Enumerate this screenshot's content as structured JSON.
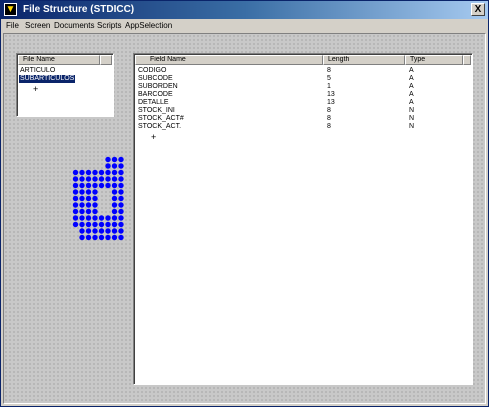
{
  "window": {
    "title": "File Structure (STDICC)",
    "close_label": "X"
  },
  "menu": [
    "File",
    "Screen",
    "Documents",
    "Scripts",
    "AppSelection"
  ],
  "files_panel": {
    "header": "File Name",
    "items": [
      "ARTICULO",
      "SUBARTICULOS"
    ],
    "selected_index": 1,
    "add_symbol": "+"
  },
  "fields_panel": {
    "columns": [
      "Field Name",
      "Length",
      "Type"
    ],
    "rows": [
      [
        "CODIGO",
        "8",
        "A"
      ],
      [
        "SUBCODE",
        "5",
        "A"
      ],
      [
        "SUBORDEN",
        "1",
        "A"
      ],
      [
        "BARCODE",
        "13",
        "A"
      ],
      [
        "DETALLE",
        "13",
        "A"
      ],
      [
        "STOCK_INI",
        "8",
        "N"
      ],
      [
        "STOCK_ACT#",
        "8",
        "N"
      ],
      [
        "STOCK_ACT.",
        "8",
        "N"
      ]
    ],
    "add_symbol": "+"
  },
  "icons": {
    "app": "app-logo-icon",
    "close": "close-icon",
    "decor": "blue-dot-pattern-icon"
  },
  "colors": {
    "titlebar": "#0a246a",
    "selection": "#0a246a",
    "dots": "#0000ff"
  }
}
